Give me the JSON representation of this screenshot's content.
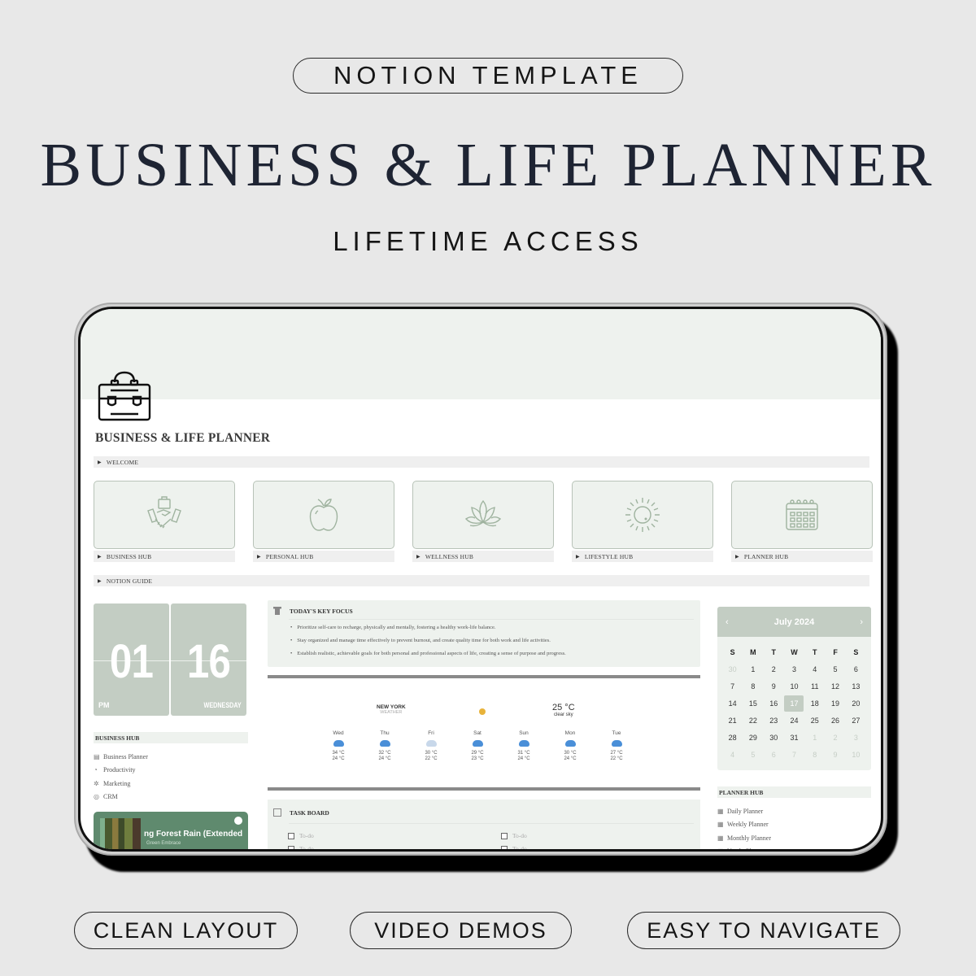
{
  "banner": {
    "top_pill": "NOTION TEMPLATE",
    "title": "BUSINESS & LIFE PLANNER",
    "subtitle": "LIFETIME ACCESS",
    "features": [
      "CLEAN LAYOUT",
      "VIDEO DEMOS",
      "EASY TO NAVIGATE"
    ]
  },
  "page": {
    "icon": "briefcase-icon",
    "title": "BUSINESS & LIFE PLANNER",
    "welcome_toggle": "WELCOME",
    "notion_guide_toggle": "NOTION GUIDE",
    "hubs": [
      {
        "label": "BUSINESS HUB",
        "icon": "handshake-icon"
      },
      {
        "label": "PERSONAL HUB",
        "icon": "apple-icon"
      },
      {
        "label": "WELLNESS HUB",
        "icon": "lotus-icon"
      },
      {
        "label": "LIFESTYLE HUB",
        "icon": "sun-icon"
      },
      {
        "label": "PLANNER HUB",
        "icon": "calendar-icon"
      }
    ]
  },
  "clock": {
    "hour": "01",
    "minute": "16",
    "ampm": "PM",
    "weekday": "WEDNESDAY"
  },
  "business_hub": {
    "heading": "BUSINESS HUB",
    "items": [
      "Business Planner",
      "Productivity",
      "Marketing",
      "CRM"
    ]
  },
  "spotify": {
    "track": "ng Forest Rain (Extended",
    "artist": "Green Embrace"
  },
  "key_focus": {
    "heading": "TODAY'S KEY FOCUS",
    "items": [
      "Prioritize self-care to recharge, physically and mentally, fostering a healthy work-life balance.",
      "Stay organized and manage time effectively to prevent burnout, and create quality time for both work and life activities.",
      "Establish realistic, achievable goals for both personal and professional aspects of life, creating a sense of purpose and progress."
    ]
  },
  "weather": {
    "city": "NEW YORK",
    "label": "WEATHER",
    "current_temp": "25 °C",
    "current_desc": "clear sky",
    "days": [
      {
        "day": "Wed",
        "high": "34 °C",
        "low": "24 °C",
        "icon": "rain-cloud-icon"
      },
      {
        "day": "Thu",
        "high": "32 °C",
        "low": "24 °C",
        "icon": "rain-cloud-icon"
      },
      {
        "day": "Fri",
        "high": "30 °C",
        "low": "22 °C",
        "icon": "partly-cloudy-night-icon"
      },
      {
        "day": "Sat",
        "high": "29 °C",
        "low": "23 °C",
        "icon": "rain-cloud-icon"
      },
      {
        "day": "Sun",
        "high": "31 °C",
        "low": "24 °C",
        "icon": "rain-cloud-icon"
      },
      {
        "day": "Mon",
        "high": "30 °C",
        "low": "24 °C",
        "icon": "rain-cloud-icon"
      },
      {
        "day": "Tue",
        "high": "27 °C",
        "low": "22 °C",
        "icon": "rain-cloud-icon"
      }
    ]
  },
  "task_board": {
    "heading": "TASK BOARD",
    "todos": [
      "To-do",
      "To-do",
      "To-do",
      "To-do"
    ]
  },
  "calendar": {
    "month_label": "July 2024",
    "prev": "‹",
    "next": "›",
    "weekdays": [
      "S",
      "M",
      "T",
      "W",
      "T",
      "F",
      "S"
    ],
    "days": [
      {
        "d": "30",
        "muted": true
      },
      {
        "d": "1"
      },
      {
        "d": "2"
      },
      {
        "d": "3"
      },
      {
        "d": "4"
      },
      {
        "d": "5"
      },
      {
        "d": "6"
      },
      {
        "d": "7"
      },
      {
        "d": "8"
      },
      {
        "d": "9"
      },
      {
        "d": "10"
      },
      {
        "d": "11"
      },
      {
        "d": "12"
      },
      {
        "d": "13"
      },
      {
        "d": "14"
      },
      {
        "d": "15"
      },
      {
        "d": "16"
      },
      {
        "d": "17",
        "today": true
      },
      {
        "d": "18"
      },
      {
        "d": "19"
      },
      {
        "d": "20"
      },
      {
        "d": "21"
      },
      {
        "d": "22"
      },
      {
        "d": "23"
      },
      {
        "d": "24"
      },
      {
        "d": "25"
      },
      {
        "d": "26"
      },
      {
        "d": "27"
      },
      {
        "d": "28"
      },
      {
        "d": "29"
      },
      {
        "d": "30"
      },
      {
        "d": "31"
      },
      {
        "d": "1",
        "muted": true
      },
      {
        "d": "2",
        "muted": true
      },
      {
        "d": "3",
        "muted": true
      },
      {
        "d": "4",
        "muted": true
      },
      {
        "d": "5",
        "muted": true
      },
      {
        "d": "6",
        "muted": true
      },
      {
        "d": "7",
        "muted": true
      },
      {
        "d": "8",
        "muted": true
      },
      {
        "d": "9",
        "muted": true
      },
      {
        "d": "10",
        "muted": true
      }
    ]
  },
  "planner_hub": {
    "heading": "PLANNER HUB",
    "items": [
      "Daily Planner",
      "Weekly Planner",
      "Monthly Planner",
      "Yearly Planner"
    ]
  },
  "colors": {
    "background": "#e8e8e8",
    "sage_light": "#eef2ee",
    "sage": "#c3cdc3",
    "spotify_green": "#5f8a6e",
    "title_navy": "#1e2433"
  }
}
